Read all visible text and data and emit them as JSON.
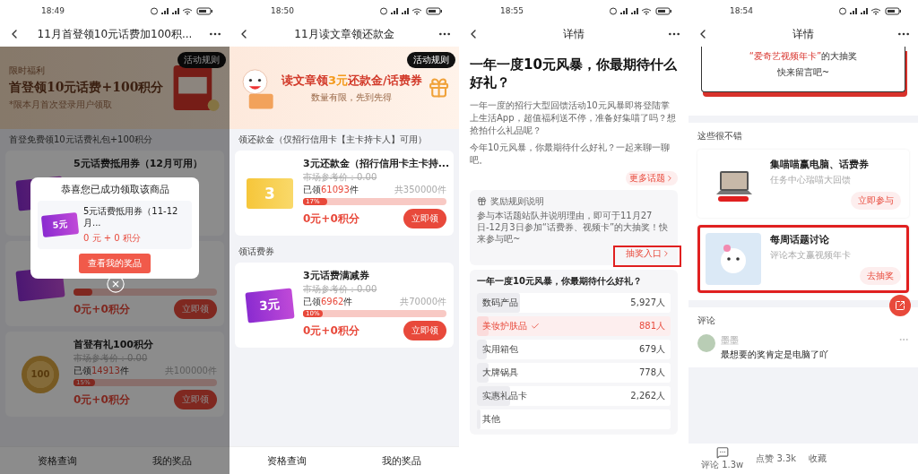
{
  "phones": [
    {
      "kind": "coupons",
      "time": "18:49",
      "title": "11月首登领10元话费加100积...",
      "banner": {
        "kind": "first-login",
        "rules": "活动规则",
        "eyebrow": "限时福利",
        "headline": "首登领10元话费+100积分",
        "note": "*限本月首次登录用户领取"
      },
      "sections": [
        {
          "heading": "首登免费领10元话费礼包+100积分",
          "items": [
            {
              "kind": "ticket-purple",
              "title": "5元话费抵用券（12月可用）"
            },
            {
              "kind": "ticket-purple",
              "level": 0.13,
              "price": "0元+0积分",
              "button": "立即领"
            },
            {
              "kind": "coins",
              "art_label": "100",
              "title": "首登有礼100积分",
              "ref": "市场参考价：0.00",
              "claimed": "已领**14913**件",
              "total": "共100000件",
              "level": 0.15,
              "pct": "15%",
              "price": "0元+0积分",
              "button": "立即领"
            }
          ]
        }
      ],
      "dialog": {
        "title": "恭喜您已成功领取该商品",
        "item_title": "5元话费抵用券（11-12月...",
        "art_label": "5元",
        "price": "0 元 + 0 积分",
        "button": "查看我的奖品"
      },
      "footer": [
        "资格查询",
        "我的奖品"
      ]
    },
    {
      "kind": "coupons",
      "time": "18:50",
      "title": "11月读文章领还款金",
      "banner": {
        "kind": "reading",
        "rules": "活动规则",
        "headline": "读文章领**3元**还款金/话费券",
        "note": "数量有限，先到先得"
      },
      "sections": [
        {
          "heading": "领还款金（仅招行信用卡【主卡持卡人】可用）",
          "items": [
            {
              "kind": "ticket-gold",
              "art_label": "3",
              "title": "3元还款金（招行信用卡主卡持...",
              "ref": "市场参考价：0.00",
              "claimed": "已领**61093**件",
              "total": "共350000件",
              "level": 0.17,
              "pct": "17%",
              "price": "0元+0积分",
              "button": "立即领"
            }
          ]
        },
        {
          "heading": "领话费券",
          "items": [
            {
              "kind": "ticket-purple",
              "art_label": "3元",
              "title": "3元话费满减券",
              "ref": "市场参考价：0.00",
              "claimed": "已领**6962**件",
              "total": "共70000件",
              "level": 0.1,
              "pct": "10%",
              "price": "0元+0积分",
              "button": "立即领"
            }
          ]
        }
      ],
      "footer": [
        "资格查询",
        "我的奖品"
      ]
    },
    {
      "kind": "topic",
      "time": "18:55",
      "title": "详情",
      "heading": "一年一度10元风暴，你最期待什么好礼？",
      "paragraphs": [
        "一年一度的招行大型回馈活动10元风暴即将登陆掌上生活App，超值福利送不停，准备好集喵了吗？想抢拍什么礼品呢？",
        "今年10元风暴，你最期待什么好礼？一起来聊一聊吧。"
      ],
      "more_link": "更多话题",
      "reward": {
        "title": "奖励规则说明",
        "text": "参与本话题站队并说明理由，即可于11月27日-12月3日参加“话费券、视频卡”的大抽奖！快来参与吧~",
        "link": "抽奖入口",
        "highlighted": true
      },
      "poll": {
        "question": "一年一度10元风暴，你最期待什么好礼？",
        "options": [
          {
            "label": "数码产品",
            "count": "5,927人",
            "level": 0.22,
            "selected": false
          },
          {
            "label": "美妆护肤品",
            "count": "881人",
            "level": 0.06,
            "selected": true
          },
          {
            "label": "实用箱包",
            "count": "679人",
            "level": 0.05,
            "selected": false
          },
          {
            "label": "大牌锅具",
            "count": "778人",
            "level": 0.06,
            "selected": false
          },
          {
            "label": "实惠礼品卡",
            "count": "2,262人",
            "level": 0.17,
            "selected": false
          },
          {
            "label": "其他",
            "level": 0.02,
            "selected": false
          }
        ]
      }
    },
    {
      "kind": "feed",
      "time": "18:54",
      "title": "详情",
      "prize_card": {
        "text": "**“爱奇艺视频年卡”**的大抽奖",
        "cta": "快来留言吧~"
      },
      "recs_heading": "这些很不错",
      "recs": [
        {
          "kind": "laptop",
          "title": "集喵喵赢电脑、话费券",
          "subtitle": "任务中心瑞喵大回馈",
          "button": "立即参与",
          "highlighted": false
        },
        {
          "kind": "mascot",
          "title": "每周话题讨论",
          "subtitle": "评论本文赢视频年卡",
          "button": "去抽奖",
          "highlighted": true
        }
      ],
      "comments_heading": "评论",
      "comments": [
        {
          "user": "墨墨",
          "text": "最想要的奖肯定是电脑了吖"
        }
      ],
      "actions": [
        {
          "kind": "comment",
          "label": "评论 1.3w"
        },
        {
          "kind": "like",
          "label": "点赞 3.3k"
        },
        {
          "kind": "favorite",
          "label": "收藏"
        }
      ]
    }
  ]
}
